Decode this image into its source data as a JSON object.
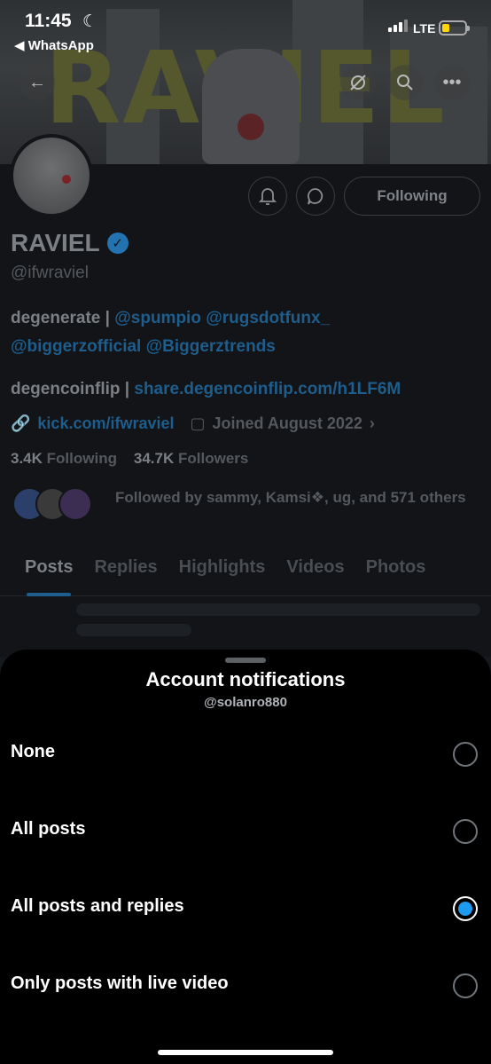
{
  "status_bar": {
    "time": "11:45",
    "back_app": "◀ WhatsApp",
    "network": "LTE"
  },
  "profile": {
    "banner_text": "RAVIEL",
    "name": "RAVIEL",
    "handle": "@ifwraviel",
    "bio_line1_prefix": "degenerate | ",
    "bio_line1_mentions": "@spumpio @rugsdotfunx_",
    "bio_line2_mentions": "@biggerzofficial @Biggerztrends",
    "bio2_prefix": "degencoinflip | ",
    "bio2_link": "share.degencoinflip.com/h1LF6M",
    "website": "kick.com/ifwraviel",
    "joined": "Joined August 2022",
    "following_count": "3.4K",
    "following_label": "Following",
    "followers_count": "34.7K",
    "followers_label": "Followers",
    "followed_by": "Followed by sammy, Kamsi❖, ug, and 571 others",
    "following_button": "Following",
    "tabs": [
      "Posts",
      "Replies",
      "Highlights",
      "Videos",
      "Photos"
    ],
    "active_tab": "Posts"
  },
  "sheet": {
    "title": "Account notifications",
    "subtitle": "@solanro880",
    "options": [
      {
        "label": "None",
        "selected": false
      },
      {
        "label": "All posts",
        "selected": false
      },
      {
        "label": "All posts and replies",
        "selected": true
      },
      {
        "label": "Only posts with live video",
        "selected": false
      }
    ]
  },
  "colors": {
    "accent": "#1d9bf0",
    "sheet_bg": "#000000",
    "verified": "#2273b0"
  }
}
